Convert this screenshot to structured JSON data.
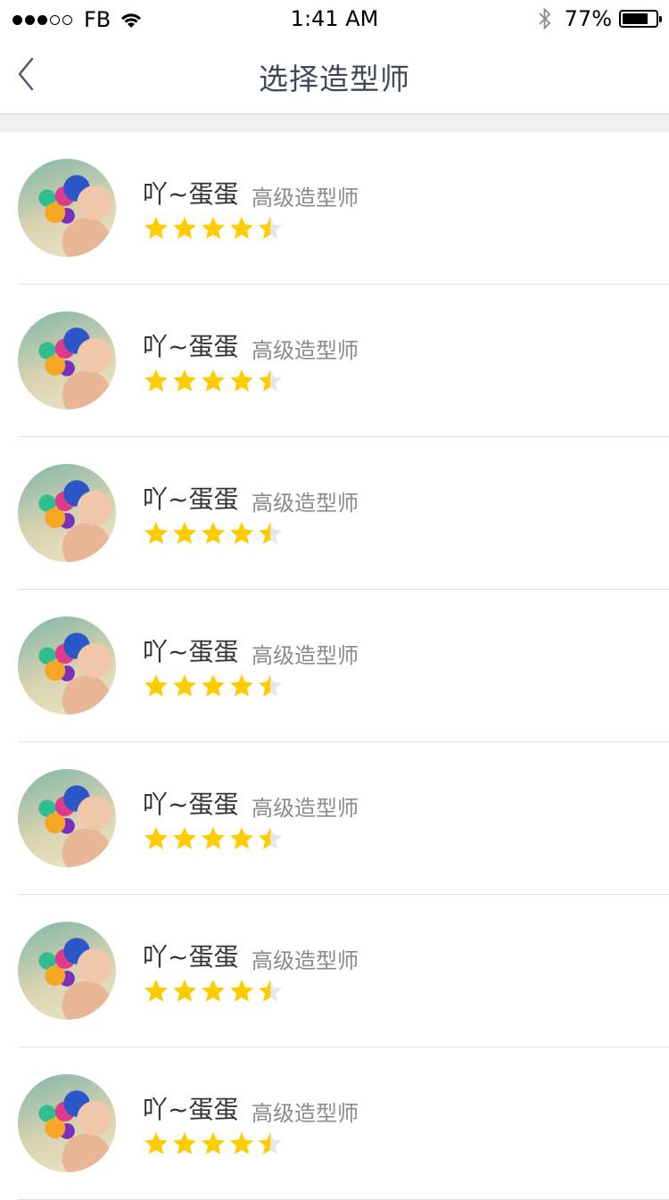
{
  "status_bar": {
    "carrier": "FB",
    "time": "1:41 AM",
    "battery_text": "77%",
    "battery_level": 0.77,
    "signal_bars_filled": 3,
    "signal_bars_total": 5
  },
  "nav": {
    "title": "选择造型师",
    "back_icon": "chevron-left-icon"
  },
  "colors": {
    "star_filled": "#FFCC00",
    "star_empty": "#E6E6E6",
    "title_color": "#3E4A5C"
  },
  "stylists": [
    {
      "name": "吖~蛋蛋",
      "title": "高级造型师",
      "rating": 4.5
    },
    {
      "name": "吖~蛋蛋",
      "title": "高级造型师",
      "rating": 4.5
    },
    {
      "name": "吖~蛋蛋",
      "title": "高级造型师",
      "rating": 4.5
    },
    {
      "name": "吖~蛋蛋",
      "title": "高级造型师",
      "rating": 4.5
    },
    {
      "name": "吖~蛋蛋",
      "title": "高级造型师",
      "rating": 4.5
    },
    {
      "name": "吖~蛋蛋",
      "title": "高级造型师",
      "rating": 4.5
    },
    {
      "name": "吖~蛋蛋",
      "title": "高级造型师",
      "rating": 4.5
    }
  ]
}
